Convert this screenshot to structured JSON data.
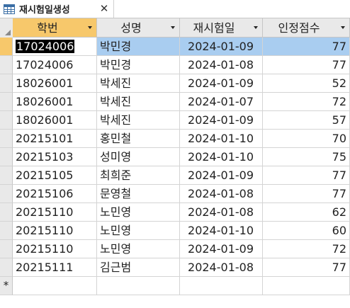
{
  "tab": {
    "title": "재시험일생성",
    "icon": "table-icon",
    "close_label": "✕"
  },
  "columns": [
    {
      "label": "학번"
    },
    {
      "label": "성명"
    },
    {
      "label": "재시험일"
    },
    {
      "label": "인정점수"
    }
  ],
  "rows": [
    {
      "id": "17024006",
      "name": "박민경",
      "date": "2024-01-09",
      "score": "77"
    },
    {
      "id": "17024006",
      "name": "박민경",
      "date": "2024-01-08",
      "score": "77"
    },
    {
      "id": "18026001",
      "name": "박세진",
      "date": "2024-01-09",
      "score": "52"
    },
    {
      "id": "18026001",
      "name": "박세진",
      "date": "2024-01-07",
      "score": "72"
    },
    {
      "id": "18026001",
      "name": "박세진",
      "date": "2024-01-09",
      "score": "57"
    },
    {
      "id": "20215101",
      "name": "홍민철",
      "date": "2024-01-10",
      "score": "70"
    },
    {
      "id": "20215103",
      "name": "성미영",
      "date": "2024-01-10",
      "score": "75"
    },
    {
      "id": "20215105",
      "name": "최희준",
      "date": "2024-01-09",
      "score": "77"
    },
    {
      "id": "20215106",
      "name": "문영철",
      "date": "2024-01-08",
      "score": "77"
    },
    {
      "id": "20215110",
      "name": "노민영",
      "date": "2024-01-08",
      "score": "62"
    },
    {
      "id": "20215110",
      "name": "노민영",
      "date": "2024-01-10",
      "score": "60"
    },
    {
      "id": "20215110",
      "name": "노민영",
      "date": "2024-01-09",
      "score": "72"
    },
    {
      "id": "20215111",
      "name": "김근범",
      "date": "2024-01-08",
      "score": "77"
    }
  ],
  "new_row_marker": "*",
  "colors": {
    "selected_row": "#a9cdf0",
    "active_header": "#f7c86b",
    "header_bg": "#e9e9e9"
  }
}
